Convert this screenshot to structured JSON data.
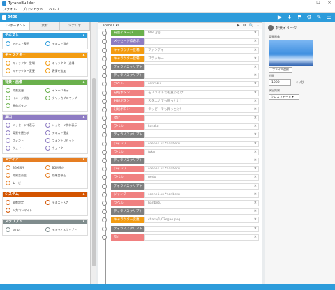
{
  "window": {
    "title": "TyranoBuilder",
    "controls": [
      "–",
      "☐",
      "✕"
    ]
  },
  "menu": [
    "ファイル",
    "プロジェクト",
    "ヘルプ"
  ],
  "toolbar": {
    "project": "0406",
    "tools": [
      "▶",
      "⬇",
      "⚑",
      "⚙",
      "✎",
      "☰"
    ]
  },
  "left": {
    "tabs": [
      "コンポーネント",
      "素材",
      "シナリオ"
    ],
    "categories": [
      {
        "title": "テキスト",
        "color": "#2d9cdb",
        "items": [
          "テキスト表示",
          "テキスト消去"
        ]
      },
      {
        "title": "キャラクター",
        "color": "#f39c12",
        "items": [
          "キャラクター登場",
          "キャラクター退場",
          "キャラクター変更",
          "表情を追加"
        ]
      },
      {
        "title": "背景・画像",
        "color": "#6ab04c",
        "items": [
          "背景変更",
          "イメージ表示",
          "イメージ消去",
          "クリッカブルマップ",
          "画像ボタン"
        ]
      },
      {
        "title": "演出",
        "color": "#8e7cc3",
        "items": [
          "メッセージ枠表示",
          "メッセージ枠非表示",
          "背景を揺らす",
          "テキスト速度",
          "フォント",
          "フォントリセット",
          "ウェイト",
          "ウェイク"
        ]
      },
      {
        "title": "メディア",
        "color": "#e67e22",
        "items": [
          "BGM再生",
          "BGM停止",
          "効果音再生",
          "効果音停止",
          "ムービー"
        ]
      },
      {
        "title": "システム",
        "color": "#d35400",
        "items": [
          "変数設定",
          "テキスト入力",
          "入力コンマイト"
        ]
      },
      {
        "title": "スクリプト",
        "color": "#7f8c8d",
        "items": [
          "script",
          "ティラノスクリプト"
        ]
      }
    ]
  },
  "center": {
    "file": "scene1.ks",
    "controls": [
      "▶",
      "⚙",
      "🔍",
      "⌄"
    ],
    "rows": [
      {
        "label": "背景イメージ",
        "value": "title.jpg",
        "color": "#6ab04c"
      },
      {
        "label": "メッセージ枠表示",
        "value": "",
        "color": "#8e7cc3"
      },
      {
        "label": "キャラクター登場",
        "value": "ファンティ",
        "color": "#f39c12"
      },
      {
        "label": "キャラクター登場",
        "value": "ブラッキー",
        "color": "#f39c12"
      },
      {
        "label": "ティラノスクリプト",
        "value": "",
        "color": "#7f7f7f"
      },
      {
        "label": "ティラノスクリプト",
        "value": "",
        "color": "#7f7f7f"
      },
      {
        "label": "ラベル",
        "value": "sentaku",
        "color": "#f08080"
      },
      {
        "label": "分岐ボタン",
        "value": "モノメイトでも買っとけ！",
        "color": "#f08080"
      },
      {
        "label": "分岐ボタン",
        "value": "スタエナでも買っとけ！",
        "color": "#f08080"
      },
      {
        "label": "分岐ボタン",
        "value": "ラッピーでも買っとけ！",
        "color": "#f08080"
      },
      {
        "label": "停止",
        "value": "",
        "color": "#f08080"
      },
      {
        "label": "ラベル",
        "value": "kuraku",
        "color": "#f08080"
      },
      {
        "label": "ティラノスクリプト",
        "value": "",
        "color": "#7f7f7f"
      },
      {
        "label": "ジャンプ",
        "value": "scene1.ks *hanbetu",
        "color": "#f08080"
      },
      {
        "label": "ラベル",
        "value": "fuku",
        "color": "#f08080"
      },
      {
        "label": "ティラノスクリプト",
        "value": "",
        "color": "#7f7f7f"
      },
      {
        "label": "ジャンプ",
        "value": "scene1.ks *hanbetu",
        "color": "#f08080"
      },
      {
        "label": "ラベル",
        "value": "nedo",
        "color": "#f08080"
      },
      {
        "label": "ティラノスクリプト",
        "value": "",
        "color": "#7f7f7f"
      },
      {
        "label": "ジャンプ",
        "value": "scene1.ks *hanbetu",
        "color": "#f08080"
      },
      {
        "label": "ラベル",
        "value": "hanbetu",
        "color": "#f08080"
      },
      {
        "label": "ティラノスクリプト",
        "value": "",
        "color": "#7f7f7f"
      },
      {
        "label": "キャラクター変更",
        "value": "chara/1/02egao.png",
        "color": "#f39c12"
      },
      {
        "label": "ティラノスクリプト",
        "value": "",
        "color": "#7f7f7f"
      },
      {
        "label": "停止",
        "value": "",
        "color": "#f08080"
      }
    ]
  },
  "right": {
    "title": "背景イメージ",
    "image_label": "背景画像",
    "file_button": "ファイル選択",
    "time_label": "時間",
    "time_value": "1000",
    "time_unit": "ミリ秒",
    "effect_label": "演出効果",
    "effect_value": "クロスフェード ▾"
  }
}
